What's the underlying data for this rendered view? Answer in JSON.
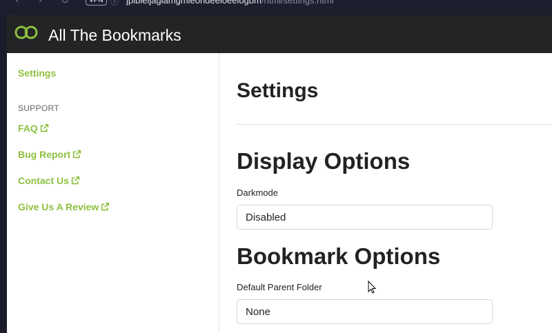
{
  "browser": {
    "vpn_label": "VPN",
    "url_host": "jpibleijagiamgmieondeeloeelogbm",
    "url_path": "/html/settings.html"
  },
  "app": {
    "title": "All The Bookmarks",
    "brand_color": "#8dc03f"
  },
  "sidebar": {
    "settings_label": "Settings",
    "support_heading": "SUPPORT",
    "support_links": [
      {
        "label": "FAQ",
        "icon": "external-link-icon"
      },
      {
        "label": "Bug Report",
        "icon": "external-link-icon"
      },
      {
        "label": "Contact Us",
        "icon": "external-link-icon"
      },
      {
        "label": "Give Us A Review",
        "icon": "external-link-icon"
      }
    ]
  },
  "main": {
    "title": "Settings",
    "display_section": {
      "title": "Display Options",
      "darkmode_label": "Darkmode",
      "darkmode_value": "Disabled"
    },
    "bookmark_section": {
      "title": "Bookmark Options",
      "parent_folder_label": "Default Parent Folder",
      "parent_folder_value": "None"
    }
  }
}
